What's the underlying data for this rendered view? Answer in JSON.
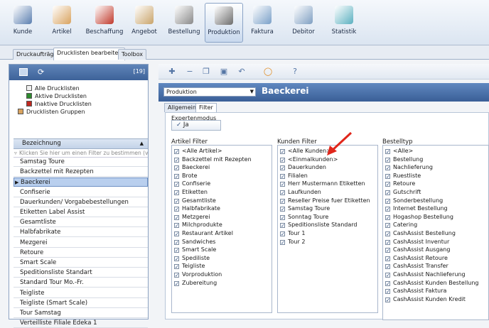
{
  "ribbon": {
    "items": [
      {
        "label": "Kunde",
        "icon": "customer-icon",
        "color": "#5b7fb0"
      },
      {
        "label": "Artikel",
        "icon": "bread-icon",
        "color": "#d9a35f"
      },
      {
        "label": "Beschaffung",
        "icon": "basket-icon",
        "color": "#c0392b"
      },
      {
        "label": "Angebot",
        "icon": "handshake-icon",
        "color": "#c9a46a"
      },
      {
        "label": "Bestellung",
        "icon": "clipboard-icon",
        "color": "#8a8a8a"
      },
      {
        "label": "Produktion",
        "icon": "oven-icon",
        "color": "#6d6d6d"
      },
      {
        "label": "Faktura",
        "icon": "invoice-icon",
        "color": "#7aa0c8"
      },
      {
        "label": "Debitor",
        "icon": "debitor-icon",
        "color": "#7f9fc2"
      },
      {
        "label": "Statistik",
        "icon": "chart-icon",
        "color": "#5bb0c0"
      }
    ]
  },
  "tabs": [
    "Druckaufträge",
    "Drucklisten bearbeiten",
    "Toolbox"
  ],
  "left": {
    "count": "[19]",
    "tree": [
      "Alle Drucklisten",
      "Aktive Drucklisten",
      "Inaktive Drucklisten",
      "Drucklisten Gruppen"
    ],
    "grid_header": "Bezeichnung",
    "filter_placeholder": "Klicken Sie hier um einen Filter zu bestimmen (verw",
    "rows": [
      "Samstag Toure",
      "Backzettel mit Rezepten",
      "Baeckerei",
      "Confiserie",
      "Dauerkunden/ Vorgabebestellungen",
      "Etiketten Label Assist",
      "Gesamtliste",
      "Halbfabrikate",
      "Mezgerei",
      "Retoure",
      "Smart Scale",
      "Speditionsliste Standart",
      "Standard Tour Mo.-Fr.",
      "Teigliste",
      "Teigliste (Smart Scale)",
      "Tour Samstag",
      "Verteilliste Filiale Edeka 1"
    ]
  },
  "right": {
    "dropdown": "Produktion",
    "title": "Baeckerei",
    "tabs": [
      "Allgemein",
      "Filter"
    ],
    "expert_label": "Expertenmodus",
    "expert_value": "Ja",
    "artikel_title": "Artikel Filter",
    "artikel": [
      "<Alle Artikel>",
      "Backzettel mit Rezepten",
      "Baeckerei",
      "Brote",
      "Confiserie",
      "Etiketten",
      "Gesamtliste",
      "Halbfabrikate",
      "Metzgerei",
      "Milchprodukte",
      "Restaurant Artikel",
      "Sandwiches",
      "Smart Scale",
      "Spediliste",
      "Teigliste",
      "Vorproduktion",
      "Zubereitung"
    ],
    "kunden_title": "Kunden Filter",
    "kunden": [
      "<Alle Kunden>",
      "<Einmalkunden>",
      "Dauerkunden",
      "Filialen",
      "Herr Mustermann Etiketten",
      "Laufkunden",
      "Reseller Preise fuer Etiketten",
      "Samstag Toure",
      "Sonntag Toure",
      "Speditionsliste Standard",
      "Tour 1",
      "Tour 2"
    ],
    "bestell_title": "Bestelltyp",
    "bestell": [
      "<Alle>",
      "Bestellung",
      "Nachlieferung",
      "Ruestliste",
      "Retoure",
      "Gutschrift",
      "Sonderbestellung",
      "Internet Bestellung",
      "Hogashop Bestellung",
      "Catering",
      "CashAssist Bestellung",
      "CashAssist Inventur",
      "CashAssist Ausgang",
      "CashAssist Retoure",
      "CashAssist Transfer",
      "CashAssist Nachlieferung",
      "CashAssist Kunden Bestellung",
      "CashAssist Faktura",
      "CashAssist Kunden Kredit"
    ]
  }
}
